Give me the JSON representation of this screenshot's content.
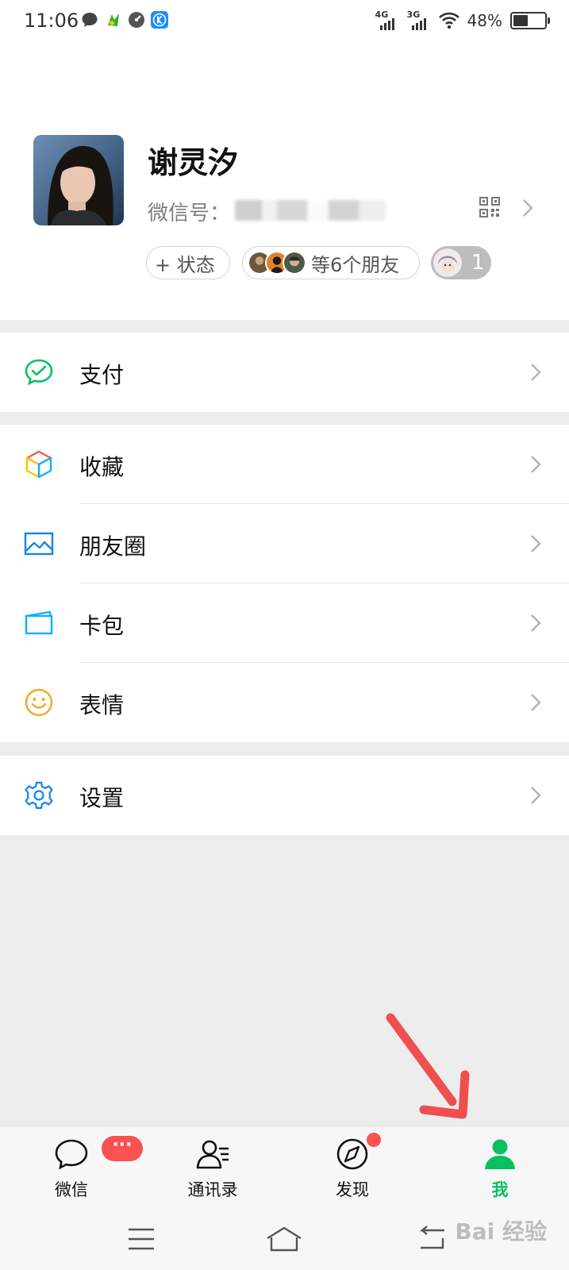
{
  "status_bar": {
    "time": "11:06",
    "network_1": "4G",
    "network_2": "3G",
    "battery_percent": "48%",
    "battery_level": 0.48
  },
  "profile": {
    "name": "谢灵汐",
    "wechat_id_label": "微信号：",
    "wechat_id_value": "",
    "status_button_label": "+ 状态",
    "friends_label": "等6个朋友",
    "count_badge": "1"
  },
  "menu": {
    "pay": {
      "label": "支付",
      "icon": "wechat-pay-icon"
    },
    "favorites": {
      "label": "收藏",
      "icon": "cube-icon"
    },
    "moments": {
      "label": "朋友圈",
      "icon": "image-icon"
    },
    "cards": {
      "label": "卡包",
      "icon": "card-icon"
    },
    "stickers": {
      "label": "表情",
      "icon": "smiley-icon"
    },
    "settings": {
      "label": "设置",
      "icon": "gear-icon"
    }
  },
  "tabbar": {
    "chats": {
      "label": "微信",
      "badge": "···"
    },
    "contacts": {
      "label": "通讯录"
    },
    "discover": {
      "label": "发现"
    },
    "me": {
      "label": "我"
    }
  },
  "colors": {
    "accent_green": "#07c160",
    "badge_red": "#fa5151",
    "background": "#ededed",
    "annotation_arrow": "#ef4f4f"
  },
  "watermark": "Bai 经验"
}
